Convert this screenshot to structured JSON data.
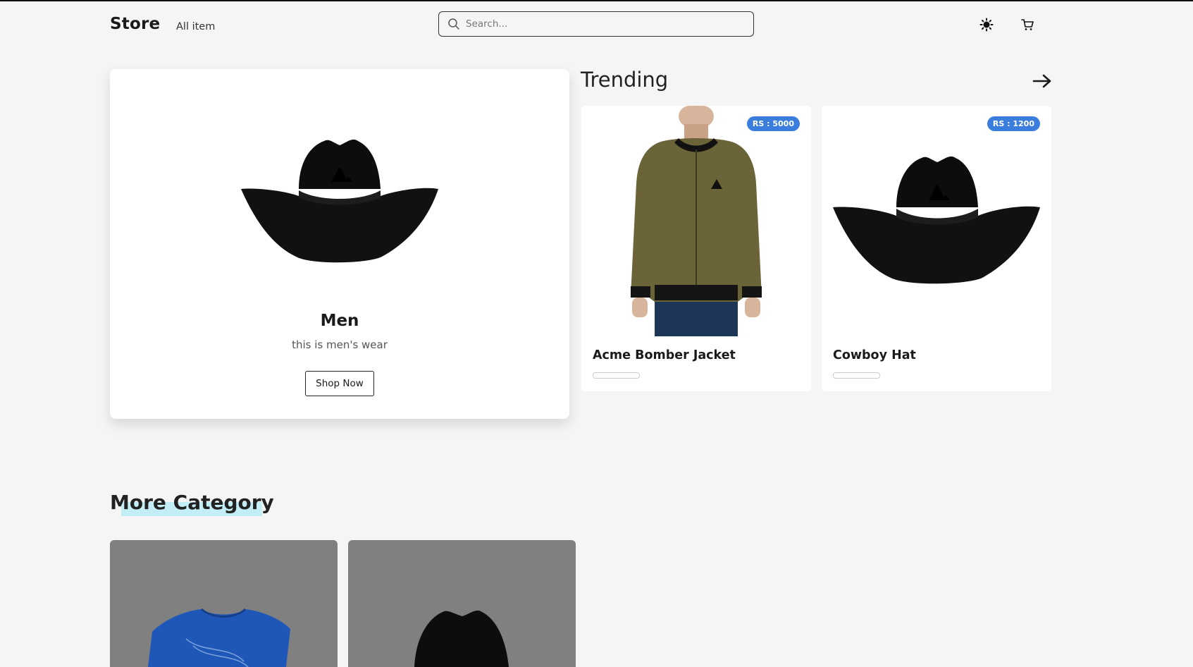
{
  "header": {
    "logo": "Store",
    "nav_link": "All item",
    "search_placeholder": "Search...",
    "theme_icon": "sun-icon",
    "cart_icon": "cart-icon"
  },
  "hero": {
    "title": "Men",
    "description": "this is men's wear",
    "button_label": "Shop Now",
    "image_icon": "cowboy-hat-image"
  },
  "trending": {
    "title": "Trending",
    "arrow_icon": "arrow-right-icon",
    "products": [
      {
        "name": "Acme Bomber Jacket",
        "price": "RS : 5000",
        "image": "bomber-jacket-image"
      },
      {
        "name": "Cowboy Hat",
        "price": "RS : 1200",
        "image": "cowboy-hat-image"
      }
    ]
  },
  "more_category": {
    "title": "More Category",
    "tiles": [
      {
        "image": "blue-tshirt-image"
      },
      {
        "image": "cowboy-hat-image"
      }
    ]
  },
  "colors": {
    "badge": "#3b7ddd",
    "highlight": "#c3eef5",
    "page_bg": "#f5f5f5"
  }
}
